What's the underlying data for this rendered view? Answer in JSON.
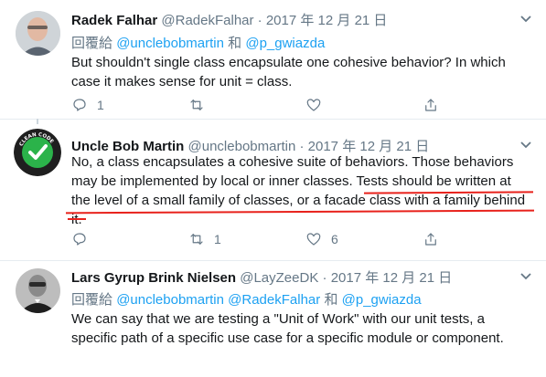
{
  "tweets": [
    {
      "name": "Radek Falhar",
      "handle": "@RadekFalhar",
      "dot": "·",
      "date": "2017 年 12 月 21 日",
      "reply_prefix": "回覆給",
      "mention1": "@unclebobmartin",
      "and_word": "和",
      "mention2": "@p_gwiazda",
      "lines": [
        "But shouldn't single class encapsulate one cohesive behavior? In which",
        "case it makes sense for unit = class."
      ],
      "reply_count": "1",
      "retweet_count": "",
      "like_count": ""
    },
    {
      "name": "Uncle Bob Martin",
      "handle": "@unclebobmartin",
      "dot": "·",
      "date": "2017 年 12 月 21 日",
      "lines": [
        "No, a class encapsulates a cohesive suite of behaviors.  Those behaviors",
        "may be implemented by local or inner classes.  Tests should be written at",
        "the level of a small family of classes, or a facade class with a family behind",
        "it."
      ],
      "reply_count": "",
      "retweet_count": "1",
      "like_count": "6"
    },
    {
      "name": "Lars Gyrup Brink Nielsen",
      "handle": "@LayZeeDK",
      "dot": "·",
      "date": "2017 年 12 月 21 日",
      "reply_prefix": "回覆給",
      "mention1": "@unclebobmartin",
      "mention2": "@RadekFalhar",
      "and_word": "和",
      "mention3": "@p_gwiazda",
      "lines": [
        "We can say that we are testing a \"Unit of Work\" with our unit tests, a",
        "specific path of a specific use case for a specific module or component."
      ]
    }
  ],
  "icons": {
    "reply": "reply-icon",
    "retweet": "retweet-icon",
    "like": "heart-icon",
    "share": "share-icon",
    "more": "chevron-down-icon"
  },
  "colors": {
    "link": "#1da1f2",
    "muted": "#657786",
    "underline": "#e8211b",
    "badge_green": "#2bb34a"
  },
  "badge_text": "CLEAN CODE"
}
